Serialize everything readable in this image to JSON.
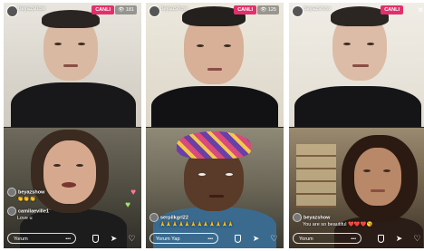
{
  "panels": [
    {
      "host_username": "beyazshow",
      "live_label": "CANLI",
      "viewer_count": "181",
      "comments": [
        {
          "user": "beyazshow",
          "text": "👏👏👏"
        },
        {
          "user": "camilaeville1",
          "text": "Love u"
        }
      ],
      "comment_placeholder": "Yorum"
    },
    {
      "host_username": "beyazshow",
      "live_label": "CANLI",
      "viewer_count": "125",
      "comments": [
        {
          "user": "serpilkgrl22",
          "text": "🙏🙏🙏🙏🙏🙏🙏🙏🙏🙏🙏🙏"
        }
      ],
      "comment_placeholder": "Yorum Yap"
    },
    {
      "host_username": "beyazshow",
      "live_label": "CANLI",
      "viewer_count": "",
      "comments": [
        {
          "user": "beyazshow",
          "text": "You are so beautiful ❤️❤️❤️😘"
        }
      ],
      "comment_placeholder": "Yorum"
    }
  ],
  "icons": {
    "close": "close-icon",
    "shield": "shield-icon",
    "send": "send-icon",
    "heart": "heart-icon",
    "more": "more-icon"
  },
  "colors": {
    "live_badge": "#e1306c",
    "heart_reaction": "#ff7aa0"
  }
}
